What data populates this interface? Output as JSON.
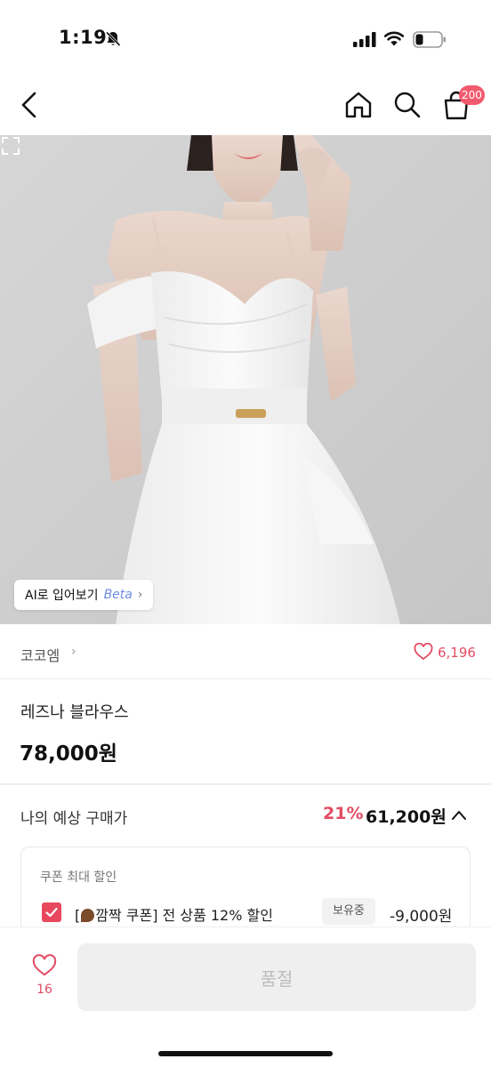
{
  "status_bar": {
    "time": "1:19",
    "icons": [
      "bell-off-icon",
      "cellular-signal-icon",
      "wifi-icon",
      "battery-icon"
    ]
  },
  "nav": {
    "icons": [
      "back-icon",
      "home-icon",
      "search-icon",
      "cart-icon"
    ],
    "cart_badge": "200"
  },
  "product_image": {
    "ai_fitting_label": "AI로 입어보기",
    "ai_fitting_tag": "Beta",
    "icons": [
      "expand-icon"
    ]
  },
  "brand": {
    "name": "코코엠",
    "likes": "6,196"
  },
  "product": {
    "name": "레즈나 블라우스",
    "price": "78,000원"
  },
  "expected_price": {
    "label": "나의 예상 구매가",
    "discount": "21%",
    "price": "61,200원"
  },
  "coupon": {
    "title": "쿠폰 최대 할인",
    "text_prefix": "[",
    "text_suffix": "깜짝 쿠폰] 전 상품 12% 할인",
    "owned_label": "보유중",
    "amount": "-9,000원",
    "checked": true
  },
  "bottom_bar": {
    "like_count": "16",
    "button_label": "품절"
  },
  "colors": {
    "accent": "#e34c63",
    "badge": "#f25a6e",
    "disabled_button_bg": "#efefef",
    "disabled_button_text": "#bdbdbd"
  }
}
